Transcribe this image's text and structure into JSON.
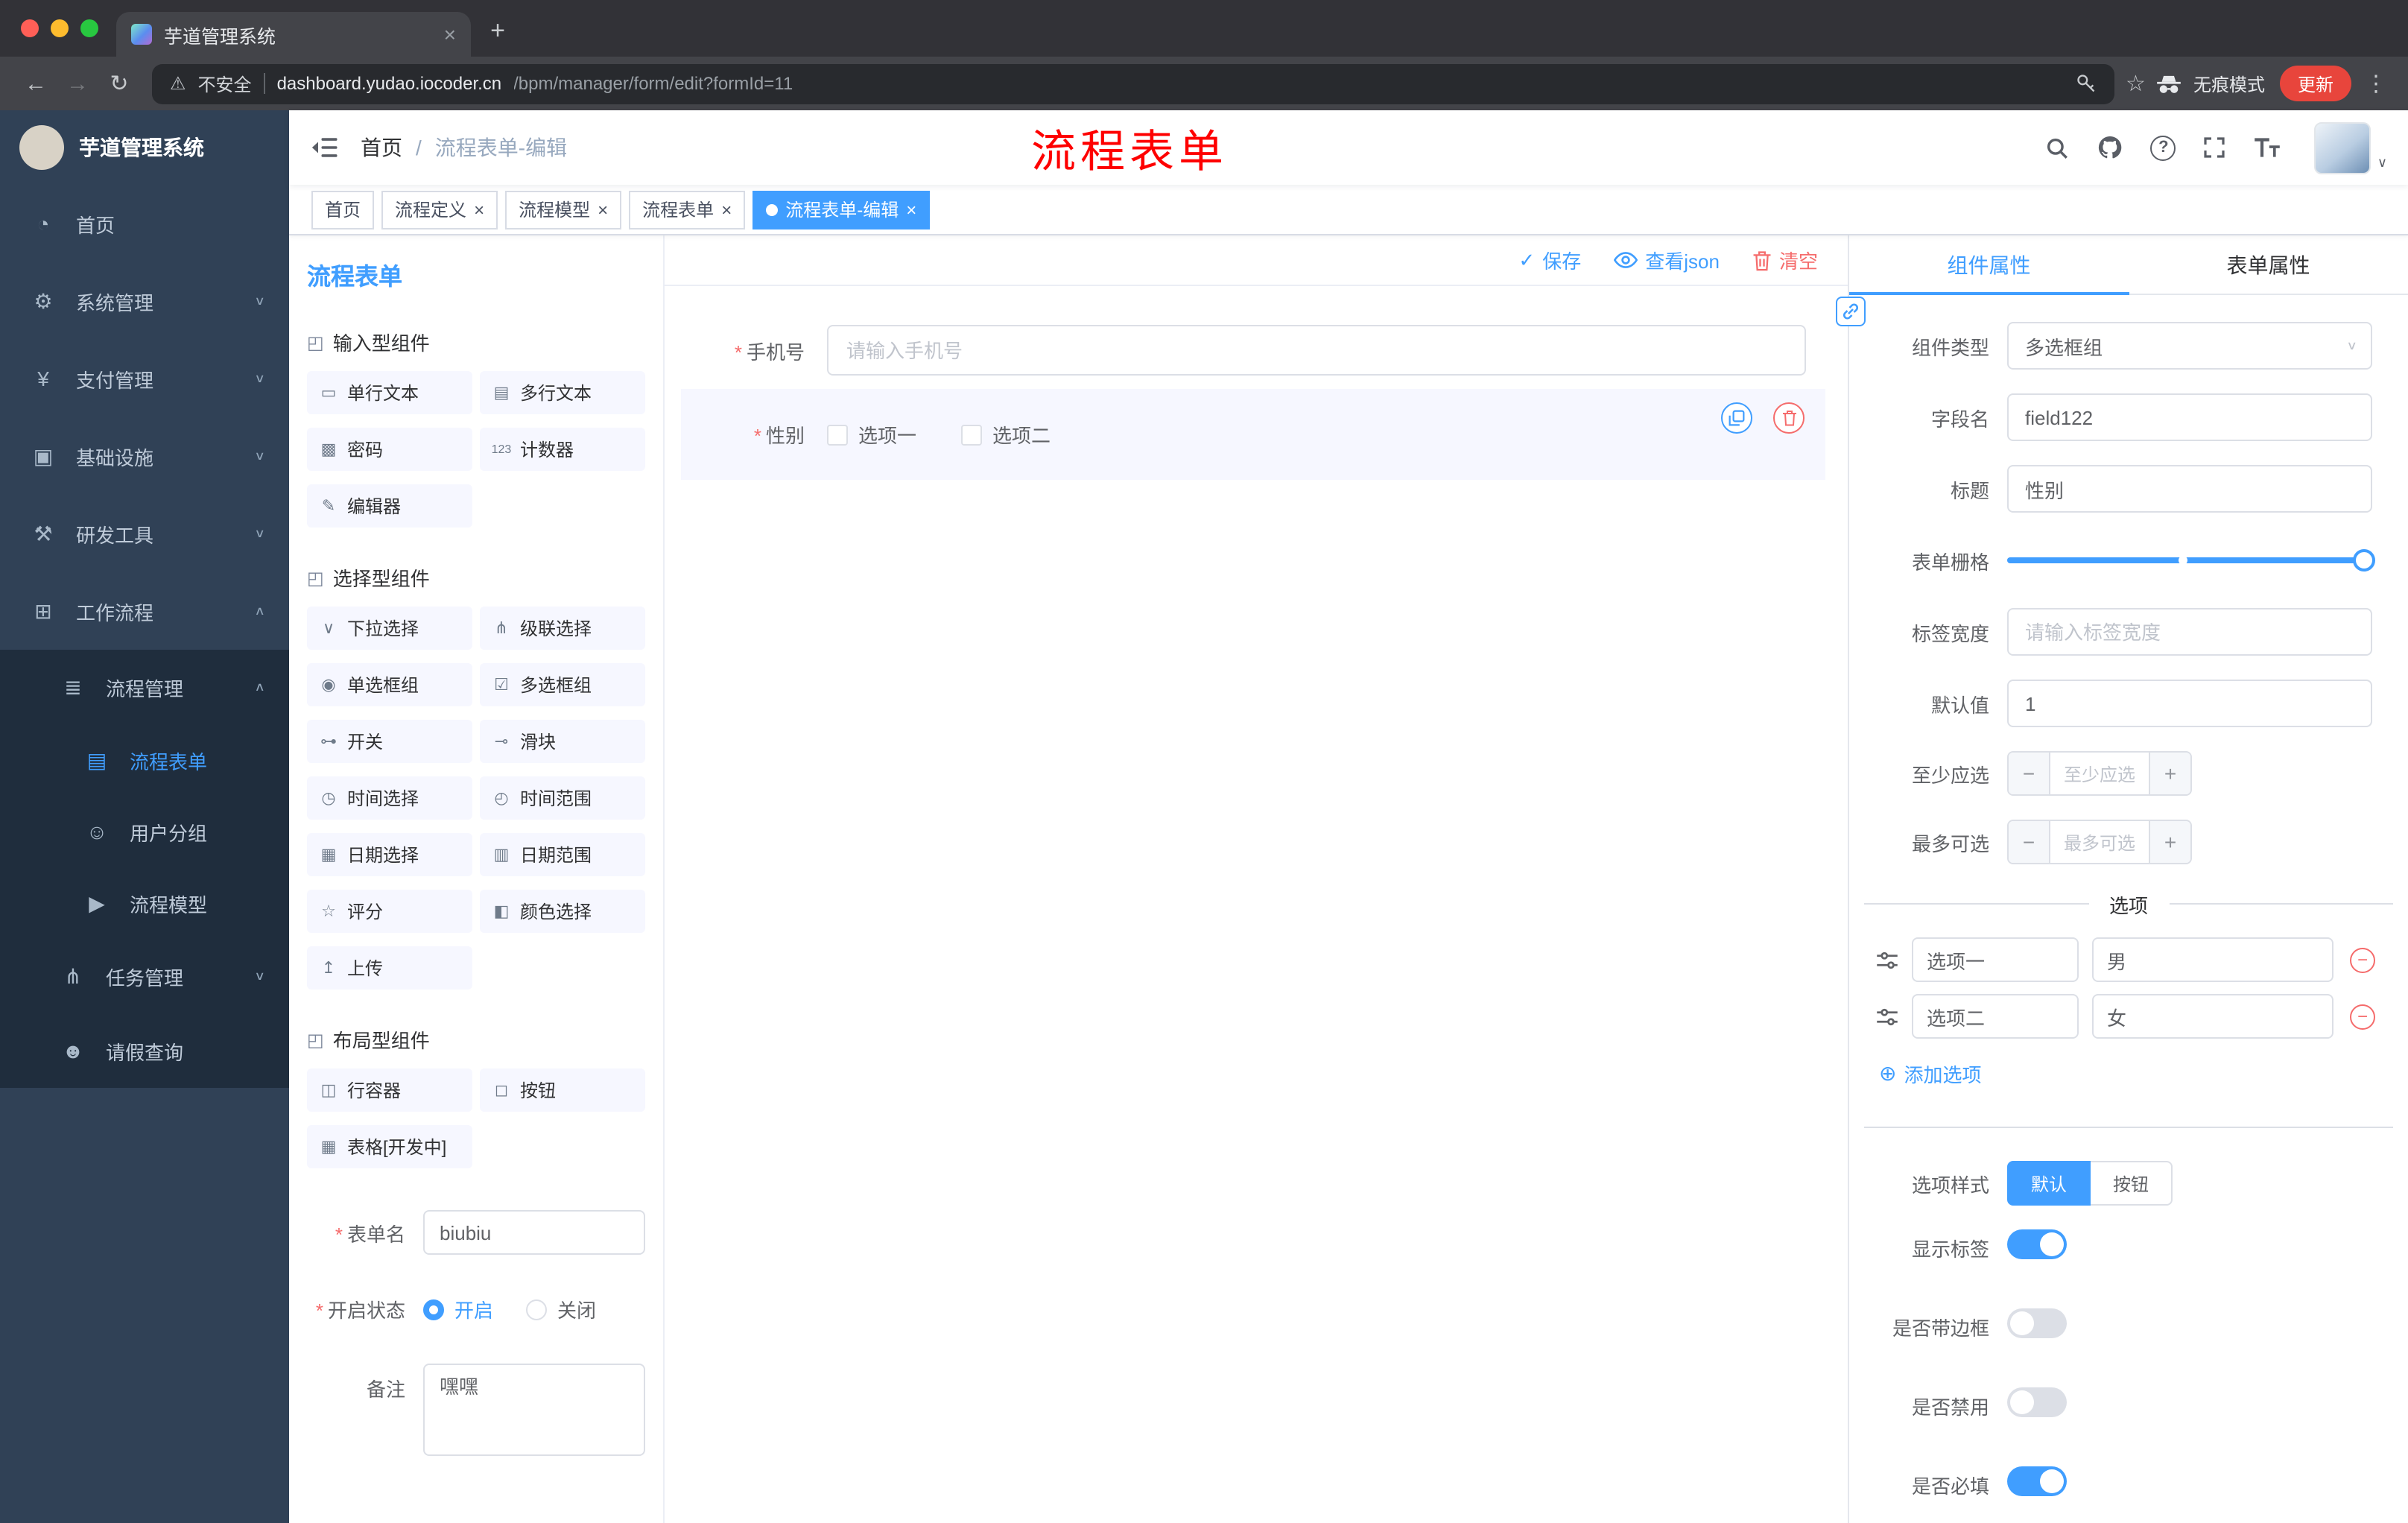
{
  "ui": {
    "asterisk": "*",
    "close": "×",
    "plus": "+",
    "minus": "−",
    "dots": "⋮",
    "star": "☆",
    "back": "←",
    "forward": "→",
    "reload": "↻",
    "warn": "⚠",
    "new_tab": "+",
    "chev_down": "∨",
    "chev_up": "∧",
    "caret_down": "∨",
    "check": "✓",
    "add_circle": "⊕",
    "section_icon": "◰"
  },
  "colors": {
    "accent": "#409eff",
    "danger": "#f56c6c",
    "tag_active": "#409eff",
    "annotation": "#fe0000"
  },
  "browser": {
    "tab_title": "芋道管理系统",
    "security": "不安全",
    "url_host": "dashboard.yudao.iocoder.cn",
    "url_path": "/bpm/manager/form/edit?formId=11",
    "incognito": "无痕模式",
    "update": "更新"
  },
  "sidebar": {
    "logo": "芋道管理系统",
    "menu": [
      {
        "icon": "◔",
        "label": "首页"
      },
      {
        "icon": "⚙",
        "label": "系统管理"
      },
      {
        "icon": "¥",
        "label": "支付管理"
      },
      {
        "icon": "▣",
        "label": "基础设施"
      },
      {
        "icon": "⚒",
        "label": "研发工具"
      },
      {
        "icon": "⊞",
        "label": "工作流程"
      }
    ],
    "sub": [
      {
        "icon": "≣",
        "label": "流程管理"
      },
      {
        "icon": "▤",
        "label": "流程表单"
      },
      {
        "icon": "☺",
        "label": "用户分组"
      },
      {
        "icon": "▶",
        "label": "流程模型"
      },
      {
        "icon": "⋔",
        "label": "任务管理"
      },
      {
        "icon": "☻",
        "label": "请假查询"
      }
    ]
  },
  "navbar": {
    "breadcrumb_home": "首页",
    "breadcrumb_sep": "/",
    "breadcrumb_current": "流程表单-编辑",
    "annotation": "流程表单"
  },
  "tags": [
    {
      "label": "首页"
    },
    {
      "label": "流程定义"
    },
    {
      "label": "流程模型"
    },
    {
      "label": "流程表单"
    },
    {
      "label": "流程表单-编辑"
    }
  ],
  "left": {
    "title": "流程表单",
    "groups": [
      {
        "title": "输入型组件",
        "items": [
          {
            "icon": "▭",
            "label": "单行文本"
          },
          {
            "icon": "▤",
            "label": "多行文本"
          },
          {
            "icon": "▩",
            "label": "密码"
          },
          {
            "icon": "123",
            "label": "计数器"
          },
          {
            "icon": "✎",
            "label": "编辑器"
          }
        ]
      },
      {
        "title": "选择型组件",
        "items": [
          {
            "icon": "∨",
            "label": "下拉选择"
          },
          {
            "icon": "⋔",
            "label": "级联选择"
          },
          {
            "icon": "◉",
            "label": "单选框组"
          },
          {
            "icon": "☑",
            "label": "多选框组"
          },
          {
            "icon": "⊶",
            "label": "开关"
          },
          {
            "icon": "⊸",
            "label": "滑块"
          },
          {
            "icon": "◷",
            "label": "时间选择"
          },
          {
            "icon": "◴",
            "label": "时间范围"
          },
          {
            "icon": "▦",
            "label": "日期选择"
          },
          {
            "icon": "▥",
            "label": "日期范围"
          },
          {
            "icon": "☆",
            "label": "评分"
          },
          {
            "icon": "◧",
            "label": "颜色选择"
          },
          {
            "icon": "↥",
            "label": "上传"
          }
        ]
      },
      {
        "title": "布局型组件",
        "items": [
          {
            "icon": "◫",
            "label": "行容器"
          },
          {
            "icon": "◻",
            "label": "按钮"
          },
          {
            "icon": "▦",
            "label": "表格[开发中]"
          }
        ]
      }
    ],
    "form": {
      "name_label": "表单名",
      "name_value": "biubiu",
      "status_label": "开启状态",
      "status_on": "开启",
      "status_off": "关闭",
      "remark_label": "备注",
      "remark_value": "嘿嘿"
    }
  },
  "canvas": {
    "save": "保存",
    "view_json": "查看json",
    "clear": "清空",
    "phone_label": "手机号",
    "phone_placeholder": "请输入手机号",
    "gender_label": "性别",
    "gender_opt1": "选项一",
    "gender_opt2": "选项二"
  },
  "props": {
    "tab_component": "组件属性",
    "tab_form": "表单属性",
    "type_label": "组件类型",
    "type_value": "多选框组",
    "field_label": "字段名",
    "field_value": "field122",
    "title_label": "标题",
    "title_value": "性别",
    "grid_label": "表单栅格",
    "width_label": "标签宽度",
    "width_placeholder": "请输入标签宽度",
    "default_label": "默认值",
    "default_value": "1",
    "min_label": "至少应选",
    "min_placeholder": "至少应选",
    "max_label": "最多可选",
    "max_placeholder": "最多可选",
    "options_title": "选项",
    "options": [
      {
        "name": "选项一",
        "value": "男"
      },
      {
        "name": "选项二",
        "value": "女"
      }
    ],
    "add_option": "添加选项",
    "style_label": "选项样式",
    "style_default": "默认",
    "style_button": "按钮",
    "sw_label": "显示标签",
    "sw_border": "是否带边框",
    "sw_disabled": "是否禁用",
    "sw_required": "是否必填"
  }
}
